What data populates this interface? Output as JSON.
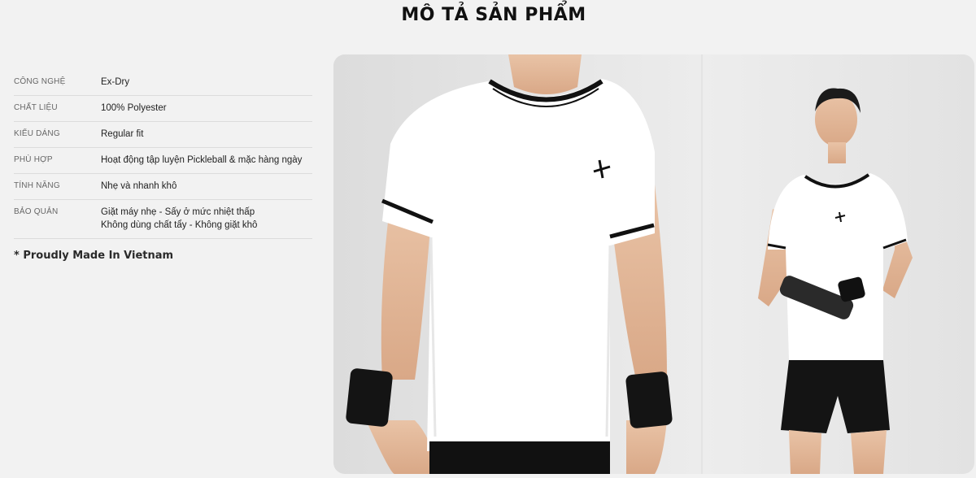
{
  "page": {
    "title": "MÔ TẢ SẢN PHẨM"
  },
  "specs": [
    {
      "label": "CÔNG NGHỆ",
      "value": [
        "Ex-Dry"
      ]
    },
    {
      "label": "CHẤT LIỆU",
      "value": [
        "100% Polyester"
      ]
    },
    {
      "label": "KIỂU DÁNG",
      "value": [
        "Regular fit"
      ]
    },
    {
      "label": "PHÙ HỢP",
      "value": [
        "Hoạt động tập luyện Pickleball & mặc hàng ngày"
      ]
    },
    {
      "label": "TÍNH NĂNG",
      "value": [
        "Nhẹ và nhanh khô"
      ]
    },
    {
      "label": "BẢO QUẢN",
      "value": [
        "Giặt máy nhẹ - Sấy ở mức nhiệt thấp",
        "Không dùng chất tẩy - Không giặt khô"
      ]
    }
  ],
  "made_in": "* Proudly Made In Vietnam",
  "images": {
    "left_photo": "product-closeup-white-tshirt",
    "right_photo": "model-full-body-white-tshirt-black-shorts"
  },
  "colors": {
    "background": "#f2f2f2",
    "shirt": "#ffffff",
    "trim": "#111111"
  }
}
